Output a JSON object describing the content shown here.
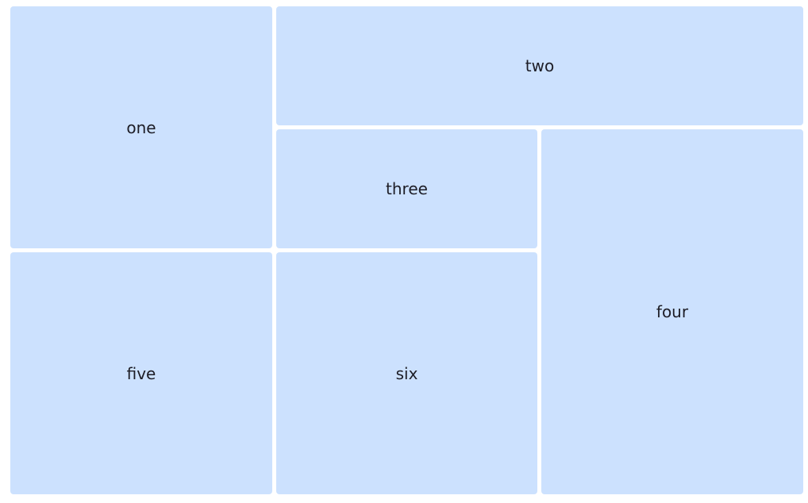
{
  "cells": {
    "one": "one",
    "two": "two",
    "three": "three",
    "four": "four",
    "five": "five",
    "six": "six"
  },
  "colors": {
    "cell_background": "#cce1fe",
    "text": "#1d1d26",
    "page_background": "#ffffff"
  }
}
